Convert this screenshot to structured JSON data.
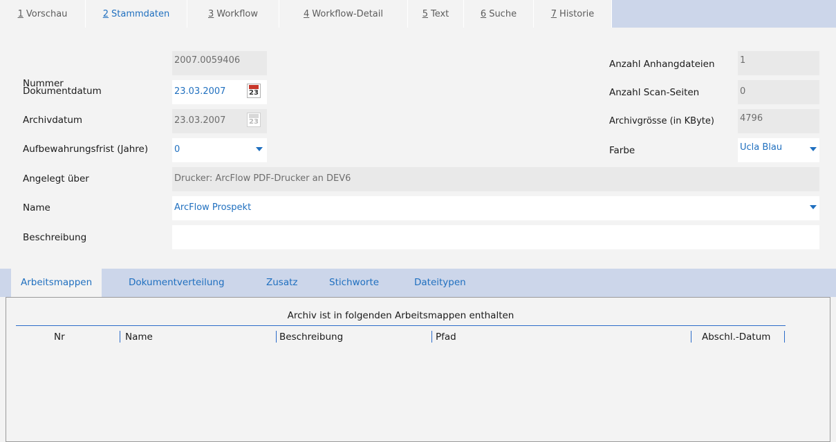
{
  "top_tabs": [
    {
      "num": "1",
      "label": "Vorschau"
    },
    {
      "num": "2",
      "label": "Stammdaten"
    },
    {
      "num": "3",
      "label": "Workflow"
    },
    {
      "num": "4",
      "label": "Workflow-Detail"
    },
    {
      "num": "5",
      "label": "Text"
    },
    {
      "num": "6",
      "label": "Suche"
    },
    {
      "num": "7",
      "label": "Historie"
    }
  ],
  "active_top_tab": "Stammdaten",
  "form": {
    "nummer": {
      "label": "Nummer",
      "value": "2007.0059406"
    },
    "dokumentdatum": {
      "label": "Dokumentdatum",
      "value": "23.03.2007",
      "calendar_day": "23"
    },
    "archivdatum": {
      "label": "Archivdatum",
      "value": "23.03.2007",
      "calendar_day": "23"
    },
    "aufbewahrungsfrist": {
      "label": "Aufbewahrungsfrist (Jahre)",
      "value": "0"
    },
    "angelegt_ueber": {
      "label": "Angelegt über",
      "value": "Drucker: ArcFlow PDF-Drucker an DEV6"
    },
    "name": {
      "label": "Name",
      "value": "ArcFlow Prospekt"
    },
    "beschreibung": {
      "label": "Beschreibung",
      "value": ""
    },
    "anzahl_anhangdateien": {
      "label": "Anzahl Anhangdateien",
      "value": "1"
    },
    "anzahl_scan_seiten": {
      "label": "Anzahl Scan-Seiten",
      "value": "0"
    },
    "archivgroesse": {
      "label": "Archivgrösse (in KByte)",
      "value": "4796"
    },
    "farbe": {
      "label": "Farbe",
      "value": "Ucla Blau"
    }
  },
  "bottom_tabs": [
    "Arbeitsmappen",
    "Dokumentverteilung",
    "Zusatz",
    "Stichworte",
    "Dateitypen"
  ],
  "active_bottom_tab": "Arbeitsmappen",
  "table": {
    "caption": "Archiv ist in folgenden Arbeitsmappen enthalten",
    "columns": [
      "Nr",
      "Name",
      "Beschreibung",
      "Pfad",
      "Abschl.-Datum"
    ],
    "rows": []
  },
  "colors": {
    "accent": "#1f6fbf",
    "tabbar": "#ccd6ea",
    "background": "#f3f3f3",
    "calendar_red": "#c7362a"
  },
  "icons": {
    "calendar": "calendar-icon",
    "dropdown": "chevron-down-icon"
  }
}
